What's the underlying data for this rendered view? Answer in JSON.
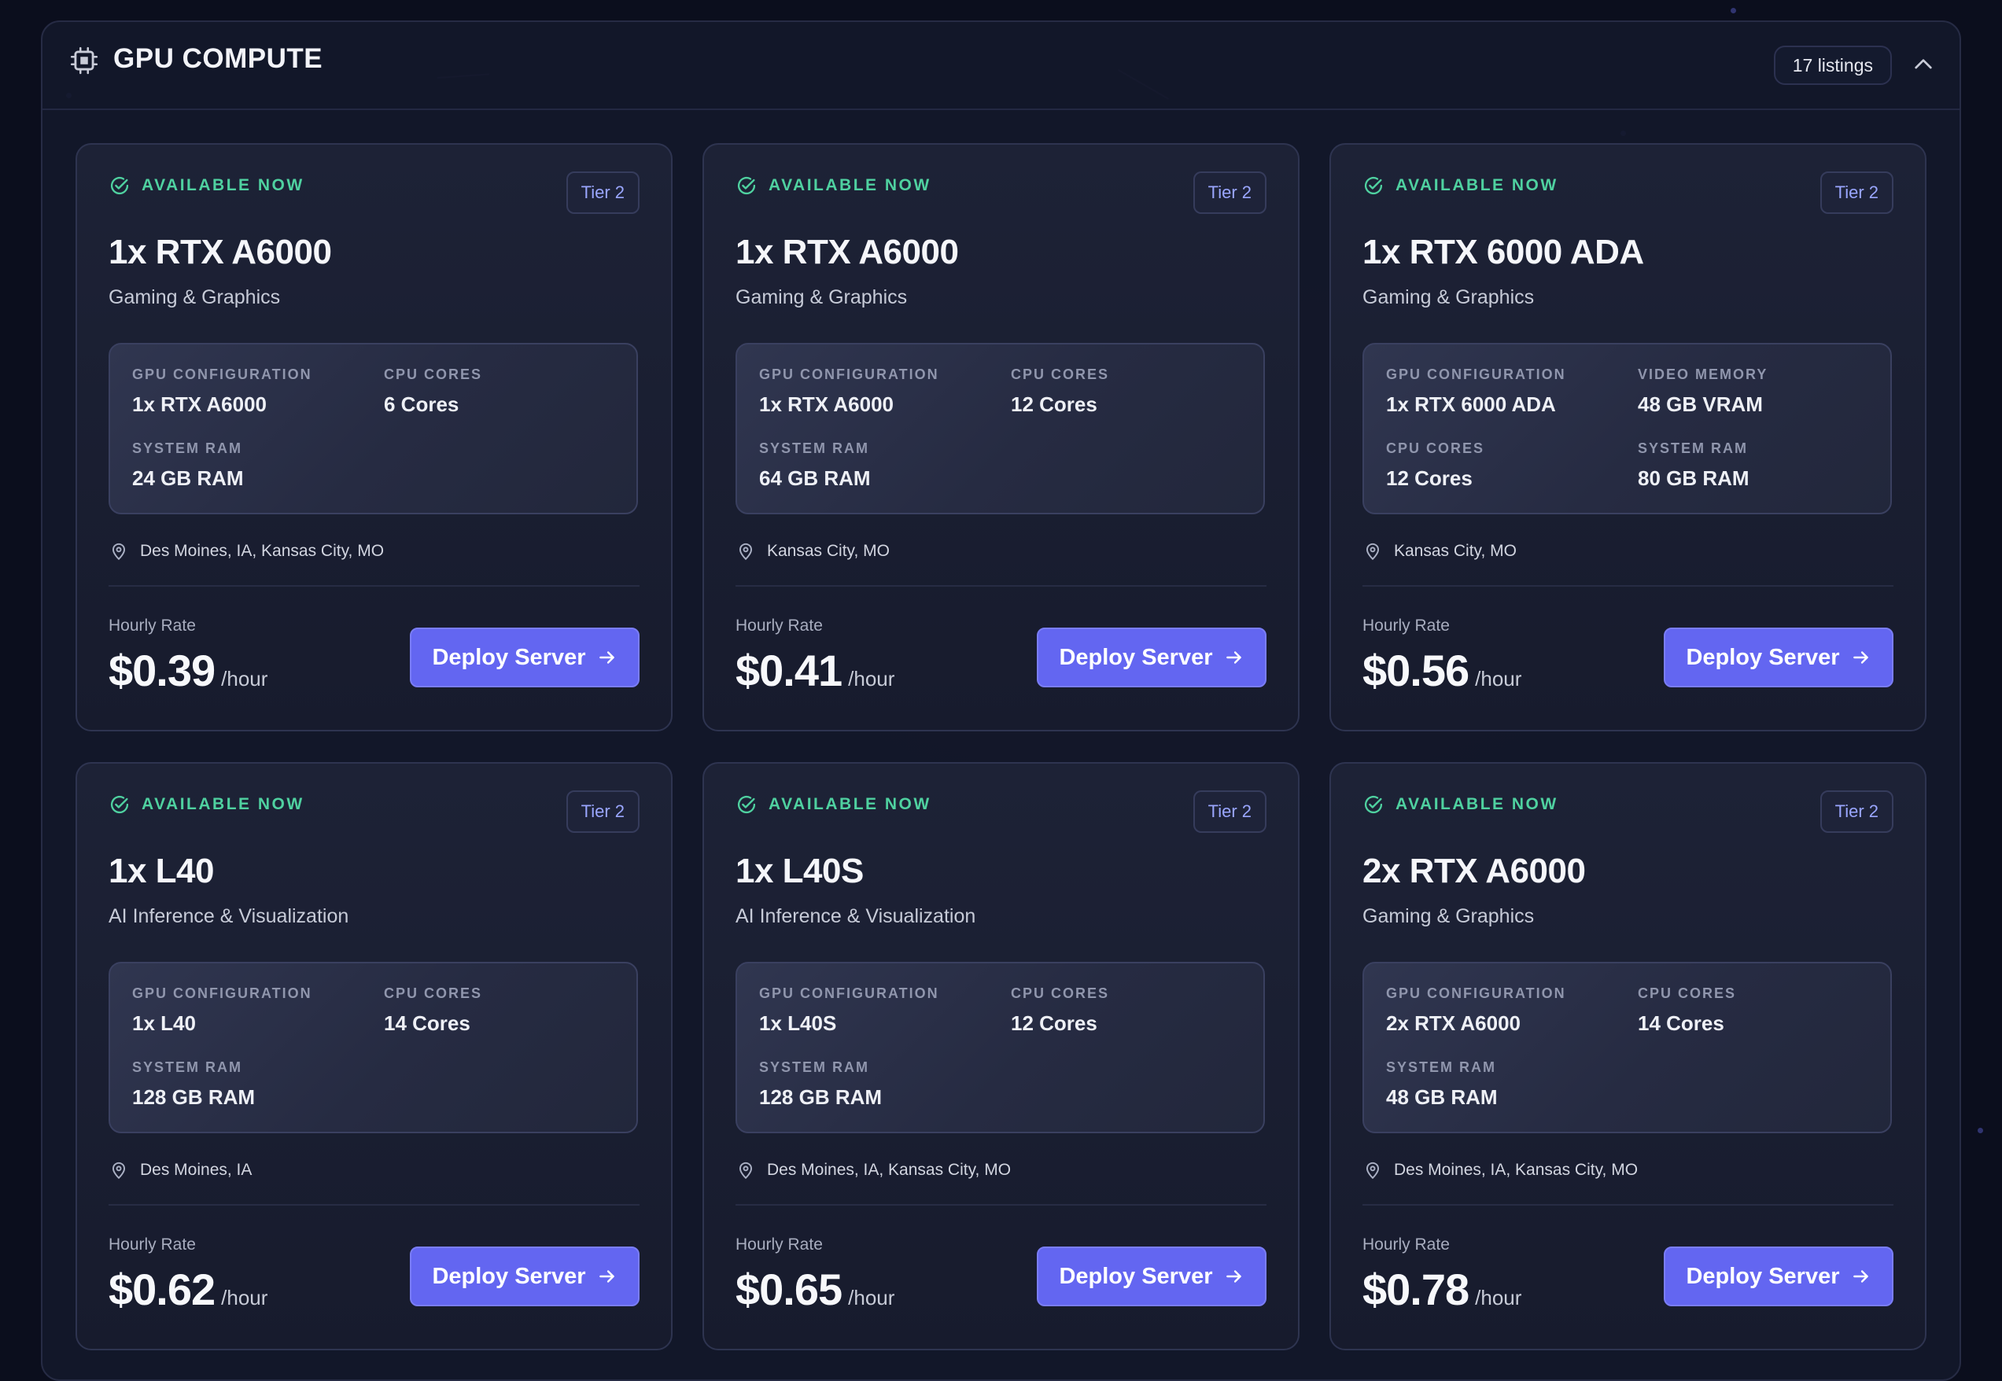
{
  "panel": {
    "title": "GPU COMPUTE",
    "listing_count": "17 listings",
    "icon": "cpu-chip-icon",
    "collapse_icon": "chevron-up-icon"
  },
  "colors": {
    "accent": "#6366f1",
    "available": "#4fd1a0",
    "tier_text": "#9aa6ff",
    "background": "#0b0e1d"
  },
  "cards": [
    {
      "status": "AVAILABLE NOW",
      "tier": "Tier 2",
      "name": "1x RTX A6000",
      "category": "Gaming & Graphics",
      "specs": [
        {
          "label": "GPU CONFIGURATION",
          "value": "1x RTX A6000"
        },
        {
          "label": "CPU CORES",
          "value": "6 Cores"
        },
        {
          "label": "SYSTEM RAM",
          "value": "24 GB RAM"
        }
      ],
      "location": "Des Moines, IA, Kansas City, MO",
      "rate_label": "Hourly Rate",
      "price": "$0.39",
      "unit": "/hour",
      "button": "Deploy Server"
    },
    {
      "status": "AVAILABLE NOW",
      "tier": "Tier 2",
      "name": "1x RTX A6000",
      "category": "Gaming & Graphics",
      "specs": [
        {
          "label": "GPU CONFIGURATION",
          "value": "1x RTX A6000"
        },
        {
          "label": "CPU CORES",
          "value": "12 Cores"
        },
        {
          "label": "SYSTEM RAM",
          "value": "64 GB RAM"
        }
      ],
      "location": "Kansas City, MO",
      "rate_label": "Hourly Rate",
      "price": "$0.41",
      "unit": "/hour",
      "button": "Deploy Server"
    },
    {
      "status": "AVAILABLE NOW",
      "tier": "Tier 2",
      "name": "1x RTX 6000 ADA",
      "category": "Gaming & Graphics",
      "specs": [
        {
          "label": "GPU CONFIGURATION",
          "value": "1x RTX 6000 ADA"
        },
        {
          "label": "VIDEO MEMORY",
          "value": "48 GB VRAM"
        },
        {
          "label": "CPU CORES",
          "value": "12 Cores"
        },
        {
          "label": "SYSTEM RAM",
          "value": "80 GB RAM"
        }
      ],
      "location": "Kansas City, MO",
      "rate_label": "Hourly Rate",
      "price": "$0.56",
      "unit": "/hour",
      "button": "Deploy Server"
    },
    {
      "status": "AVAILABLE NOW",
      "tier": "Tier 2",
      "name": "1x L40",
      "category": "AI Inference & Visualization",
      "specs": [
        {
          "label": "GPU CONFIGURATION",
          "value": "1x L40"
        },
        {
          "label": "CPU CORES",
          "value": "14 Cores"
        },
        {
          "label": "SYSTEM RAM",
          "value": "128 GB RAM"
        }
      ],
      "location": "Des Moines, IA",
      "rate_label": "Hourly Rate",
      "price": "$0.62",
      "unit": "/hour",
      "button": "Deploy Server"
    },
    {
      "status": "AVAILABLE NOW",
      "tier": "Tier 2",
      "name": "1x L40S",
      "category": "AI Inference & Visualization",
      "specs": [
        {
          "label": "GPU CONFIGURATION",
          "value": "1x L40S"
        },
        {
          "label": "CPU CORES",
          "value": "12 Cores"
        },
        {
          "label": "SYSTEM RAM",
          "value": "128 GB RAM"
        }
      ],
      "location": "Des Moines, IA, Kansas City, MO",
      "rate_label": "Hourly Rate",
      "price": "$0.65",
      "unit": "/hour",
      "button": "Deploy Server"
    },
    {
      "status": "AVAILABLE NOW",
      "tier": "Tier 2",
      "name": "2x RTX A6000",
      "category": "Gaming & Graphics",
      "specs": [
        {
          "label": "GPU CONFIGURATION",
          "value": "2x RTX A6000"
        },
        {
          "label": "CPU CORES",
          "value": "14 Cores"
        },
        {
          "label": "SYSTEM RAM",
          "value": "48 GB RAM"
        }
      ],
      "location": "Des Moines, IA, Kansas City, MO",
      "rate_label": "Hourly Rate",
      "price": "$0.78",
      "unit": "/hour",
      "button": "Deploy Server"
    }
  ]
}
